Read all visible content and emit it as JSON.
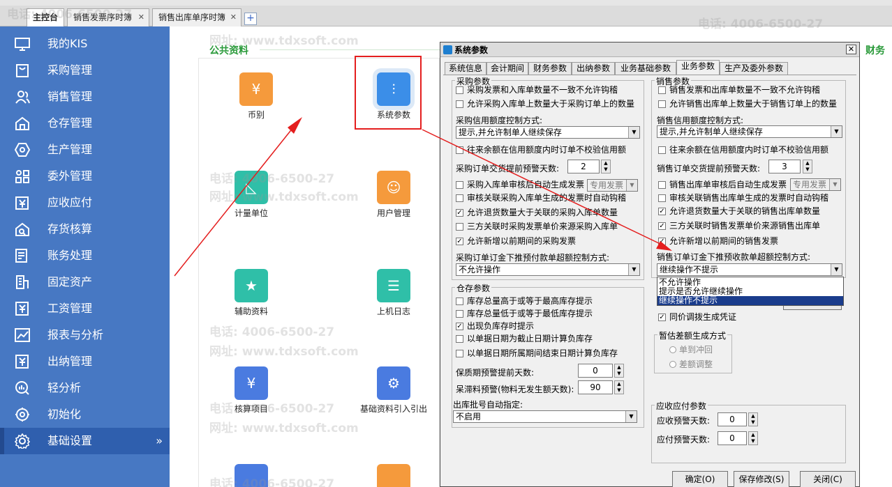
{
  "tabs": [
    {
      "label": "主控台",
      "closable": false
    },
    {
      "label": "销售发票序时簿",
      "closable": true
    },
    {
      "label": "销售出库单序时簿",
      "closable": true
    }
  ],
  "sidebar": {
    "items": [
      {
        "label": "我的KIS",
        "icon": "monitor-icon"
      },
      {
        "label": "采购管理",
        "icon": "bag-icon"
      },
      {
        "label": "销售管理",
        "icon": "people-icon"
      },
      {
        "label": "仓存管理",
        "icon": "warehouse-icon"
      },
      {
        "label": "生产管理",
        "icon": "gear-hex-icon"
      },
      {
        "label": "委外管理",
        "icon": "grid-icon"
      },
      {
        "label": "应收应付",
        "icon": "yen-doc-icon"
      },
      {
        "label": "存货核算",
        "icon": "search-house-icon"
      },
      {
        "label": "账务处理",
        "icon": "ledger-icon"
      },
      {
        "label": "固定资产",
        "icon": "building-icon"
      },
      {
        "label": "工资管理",
        "icon": "wage-icon"
      },
      {
        "label": "报表与分析",
        "icon": "chart-icon"
      },
      {
        "label": "出纳管理",
        "icon": "cashier-icon"
      },
      {
        "label": "轻分析",
        "icon": "analysis-icon"
      },
      {
        "label": "初始化",
        "icon": "init-icon"
      },
      {
        "label": "基础设置",
        "icon": "settings-icon",
        "selected": true
      }
    ],
    "expand_glyph": "»"
  },
  "main": {
    "public_title": "公共资料",
    "finance_title": "财务",
    "apps": [
      {
        "label": "币别",
        "color": "#f59a3c",
        "glyph": "¥"
      },
      {
        "label": "系统参数",
        "color": "#3b8ee8",
        "glyph": "⫶"
      },
      {
        "label": "计量单位",
        "color": "#2fbfa8",
        "glyph": "◺"
      },
      {
        "label": "用户管理",
        "color": "#f59a3c",
        "glyph": "☺"
      },
      {
        "label": "辅助资料",
        "color": "#2fbfa8",
        "glyph": "★"
      },
      {
        "label": "上机日志",
        "color": "#2fbfa8",
        "glyph": "☰"
      },
      {
        "label": "核算项目",
        "color": "#4a7be0",
        "glyph": "¥"
      },
      {
        "label": "基础资料引入引出",
        "color": "#4a7be0",
        "glyph": "⚙"
      }
    ]
  },
  "watermark": {
    "phone": "电话: 4006-6500-27",
    "site": "网址: www.tdxsoft.com"
  },
  "dialog": {
    "title": "系统参数",
    "close_glyph": "✕",
    "tabs": [
      "系统信息",
      "会计期间",
      "财务参数",
      "出纳参数",
      "业务基础参数",
      "业务参数",
      "生产及委外参数"
    ],
    "purchase": {
      "title": "采购参数",
      "checks": [
        {
          "label": "采购发票和入库单数量不一致不允许钩稽",
          "checked": false
        },
        {
          "label": "允许采购入库单上数量大于采购订单上的数量",
          "checked": false
        },
        {
          "label": "往来余额在信用额度内时订单不校验信用额",
          "checked": false
        },
        {
          "label": "采购入库单审核后自动生成发票",
          "checked": false
        },
        {
          "label": "审核关联采购入库单生成的发票时自动钩稽",
          "checked": false
        },
        {
          "label": "允许退货数量大于关联的采购入库单数量",
          "checked": true
        },
        {
          "label": "三方关联时采购发票单价来源采购入库单",
          "checked": false
        },
        {
          "label": "允许新增以前期间的采购发票",
          "checked": true
        }
      ],
      "credit_label": "采购信用额度控制方式:",
      "credit_value": "提示,并允许制单人继续保存",
      "days_label": "采购订单交货提前预警天数:",
      "days_value": "2",
      "invoice_type": "专用发票",
      "deposit_label": "采购订单订金下推预付款单超额控制方式:",
      "deposit_value": "不允许操作"
    },
    "sales": {
      "title": "销售参数",
      "checks": [
        {
          "label": "销售发票和出库单数量不一致不允许钩稽",
          "checked": false
        },
        {
          "label": "允许销售出库单上数量大于销售订单上的数量",
          "checked": false
        },
        {
          "label": "往来余额在信用额度内时订单不校验信用额",
          "checked": false
        },
        {
          "label": "销售出库单审核后自动生成发票",
          "checked": false
        },
        {
          "label": "审核关联销售出库单生成的发票时自动钩稽",
          "checked": false
        },
        {
          "label": "允许退货数量大于关联的销售出库单数量",
          "checked": true
        },
        {
          "label": "三方关联时销售发票单价来源销售出库单",
          "checked": true
        },
        {
          "label": "允许新增以前期间的销售发票",
          "checked": true
        }
      ],
      "credit_label": "销售信用额度控制方式:",
      "credit_value": "提示,并允许制单人继续保存",
      "days_label": "销售订单交货提前预警天数:",
      "days_value": "3",
      "invoice_type": "专用发票",
      "deposit_label": "销售订单订金下推预收款单超额控制方式:",
      "deposit_value": "继续操作不提示",
      "dropdown_options": [
        "不允许操作",
        "提示是否允许继续操作",
        "继续操作不提示"
      ]
    },
    "warehouse": {
      "title": "仓存参数",
      "checks": [
        {
          "label": "库存总量高于或等于最高库存提示",
          "checked": false
        },
        {
          "label": "库存总量低于或等于最低库存提示",
          "checked": false
        },
        {
          "label": "出现负库存时提示",
          "checked": true
        },
        {
          "label": "以单据日期为截止日期计算负库存",
          "checked": false
        },
        {
          "label": "以单据日期所属期间结束日期计算负库存",
          "checked": false
        }
      ],
      "shelf_label": "保质期预警提前天数:",
      "shelf_value": "0",
      "stale_label": "呆滞料预警(物料无发生额天数):",
      "stale_value": "90",
      "batch_label": "出库批号自动指定:",
      "batch_value": "不启用"
    },
    "other": {
      "transfer_check": "同价调拨生成凭证",
      "transfer_checked": true,
      "estimate_title": "暂估差额生成方式",
      "radios": [
        "单到冲回",
        "差额调整"
      ]
    },
    "arap": {
      "title": "应收应付参数",
      "receivable_label": "应收预警天数:",
      "receivable_value": "0",
      "payable_label": "应付预警天数:",
      "payable_value": "0"
    },
    "buttons": {
      "ok": "确定(O)",
      "save": "保存修改(S)",
      "close": "关闭(C)"
    }
  },
  "colors": {
    "sidebar": "#4778c3",
    "sidebar_selected": "#2f5fae",
    "highlight": "#e41e1e",
    "section_title": "#2a9a3a"
  }
}
